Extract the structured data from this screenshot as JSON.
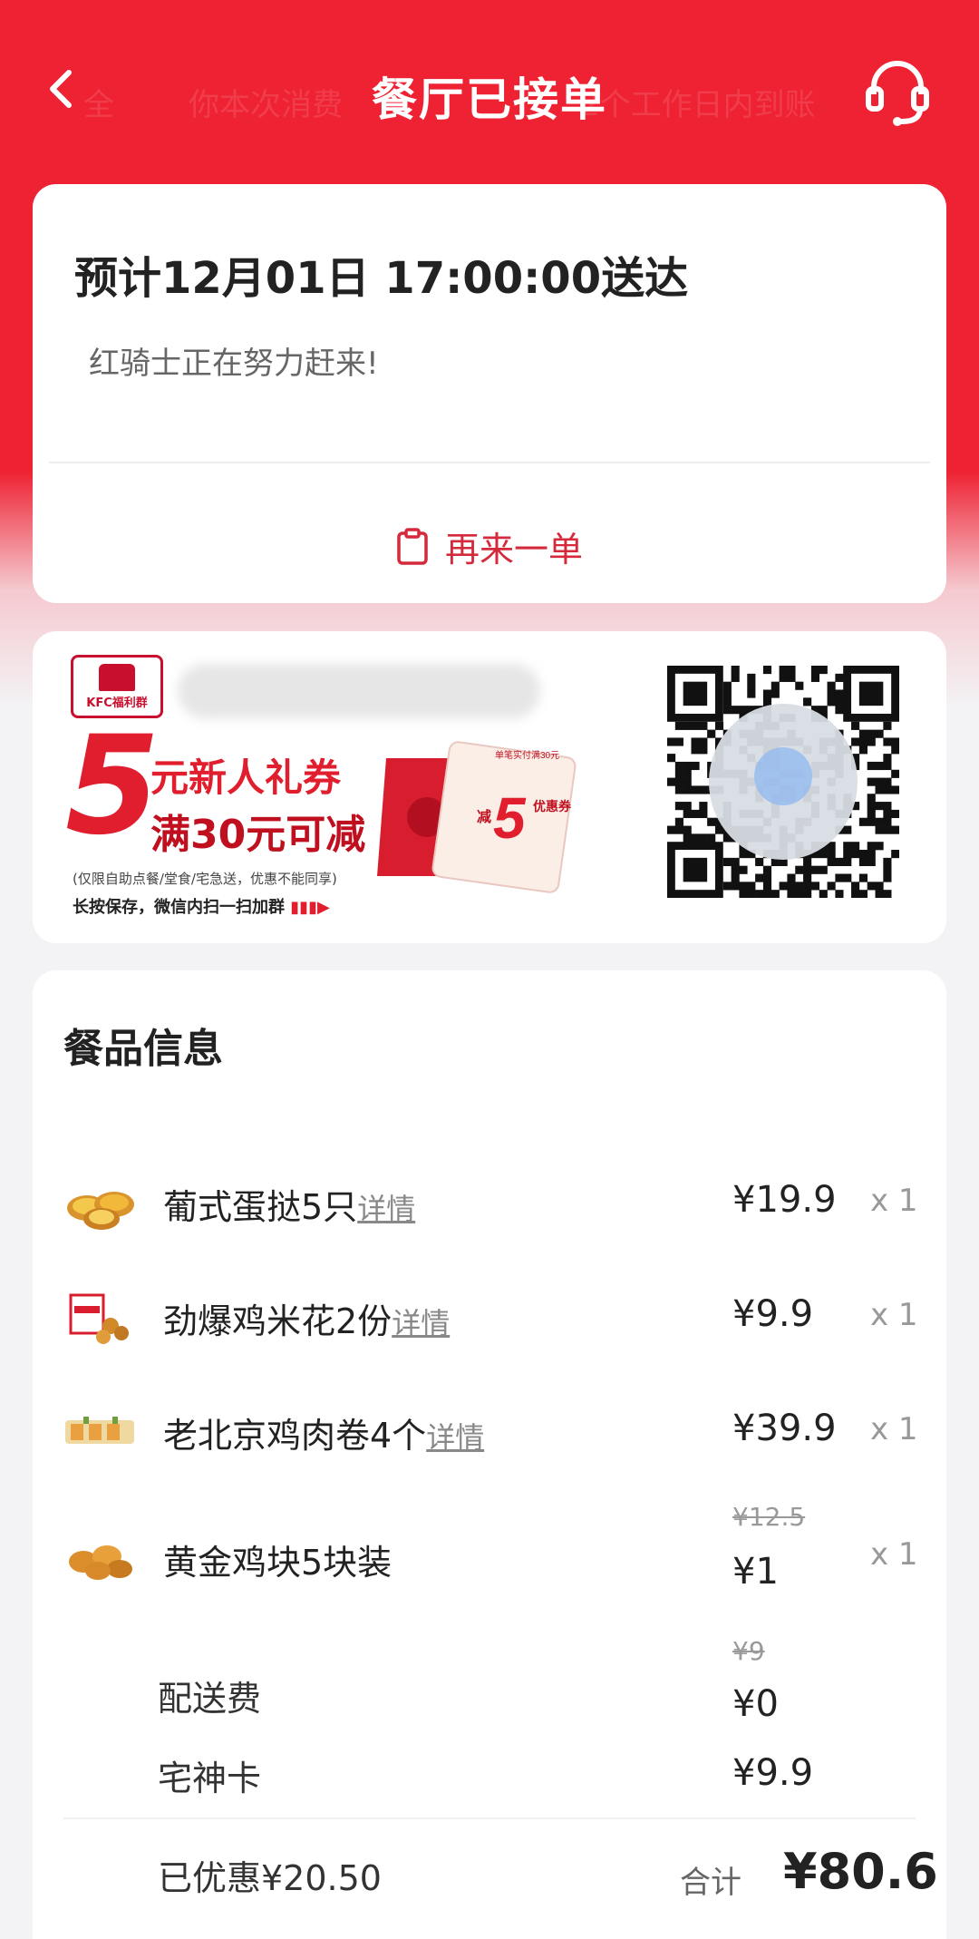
{
  "header": {
    "title": "餐厅已接单",
    "background_text_left": "全",
    "background_text_mid": "你本次消费",
    "background_text_right": "2个工作日内到账"
  },
  "status": {
    "eta": "预计12月01日 17:00:00送达",
    "message": "红骑士正在努力赶来!",
    "reorder_label": "再来一单"
  },
  "promo": {
    "logo_text": "KFC福利群",
    "amount": "5",
    "line1": "元新人礼券",
    "line2": "满30元可减",
    "note": "(仅限自助点餐/堂食/宅急送，优惠不能同享)",
    "cta": "长按保存，微信内扫一扫加群",
    "coupon_caption": "单笔实付满30元",
    "coupon_amount": "5",
    "coupon_label_minus": "减",
    "coupon_label_type": "优惠券"
  },
  "items_section": {
    "title": "餐品信息",
    "items": [
      {
        "name": "葡式蛋挞5只",
        "detail": "详情",
        "price": "¥19.9",
        "qty": "x 1"
      },
      {
        "name": "劲爆鸡米花2份",
        "detail": "详情",
        "price": "¥9.9",
        "qty": "x 1"
      },
      {
        "name": "老北京鸡肉卷4个",
        "detail": "详情",
        "price": "¥39.9",
        "qty": "x 1"
      },
      {
        "name": "黄金鸡块5块装",
        "original_price": "¥12.5",
        "price": "¥1",
        "qty": "x 1"
      }
    ],
    "delivery_fee": {
      "label": "配送费",
      "original_price": "¥9",
      "price": "¥0"
    },
    "membership": {
      "label": "宅神卡",
      "price": "¥9.9"
    },
    "saved": "已优惠¥20.50",
    "total_label": "合计",
    "total": "¥80.6"
  },
  "colors": {
    "brand_red": "#ee2233",
    "accent_red": "#d42a3b"
  }
}
